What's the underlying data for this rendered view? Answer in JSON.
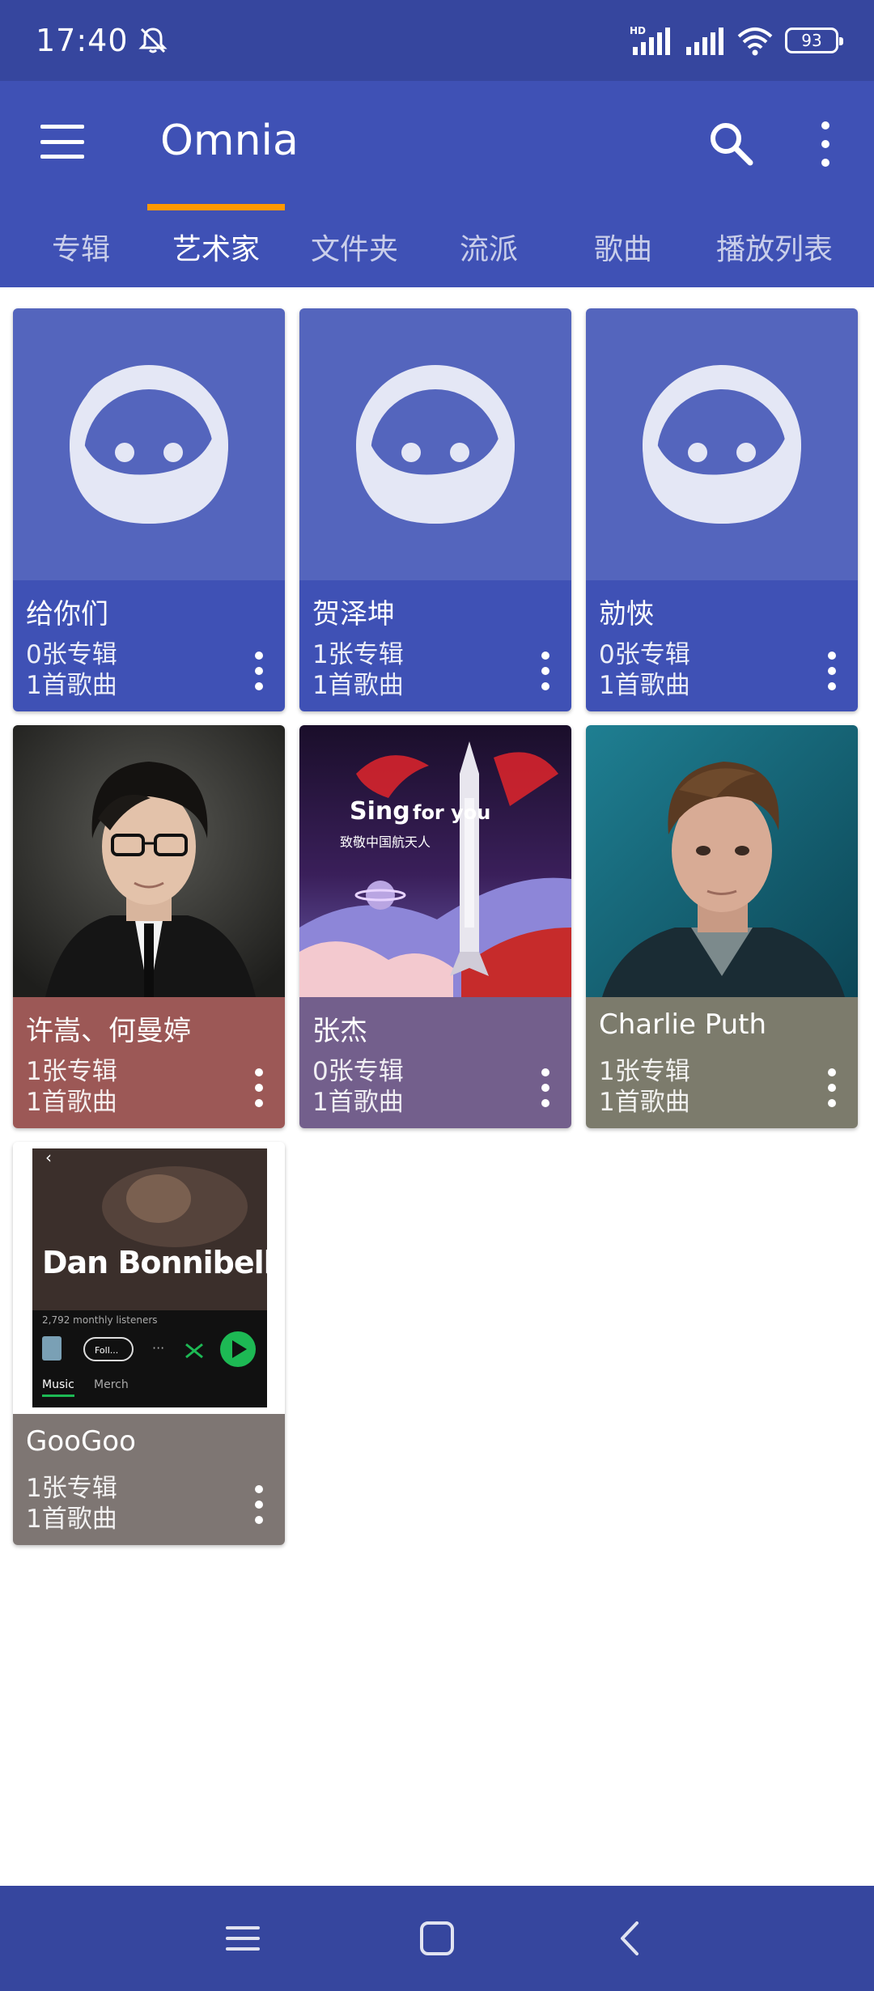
{
  "status": {
    "time": "17:40",
    "battery": "93",
    "icons": [
      "bell-off-icon",
      "hd-signal-icon",
      "signal-icon",
      "wifi-icon",
      "battery-icon"
    ]
  },
  "app_bar": {
    "title": "Omnia",
    "icons": [
      "menu-icon",
      "search-icon",
      "more-vert-icon"
    ]
  },
  "tabs": [
    {
      "label": "专辑"
    },
    {
      "label": "艺术家",
      "active": true
    },
    {
      "label": "文件夹"
    },
    {
      "label": "流派"
    },
    {
      "label": "歌曲"
    },
    {
      "label": "播放列表"
    }
  ],
  "artists": [
    {
      "name": "给你们",
      "albums": "0张专辑",
      "songs": "1首歌曲",
      "color": "#3f51b5",
      "image": "placeholder-face"
    },
    {
      "name": "贺泽坤",
      "albums": "1张专辑",
      "songs": "1首歌曲",
      "color": "#3f51b5",
      "image": "placeholder-face"
    },
    {
      "name": "勍悏",
      "albums": "0张专辑",
      "songs": "1首歌曲",
      "color": "#3f51b5",
      "image": "placeholder-face"
    },
    {
      "name": "许嵩、何曼婷",
      "albums": "1张专辑",
      "songs": "1首歌曲",
      "color": "#9c5856",
      "image": "portrait-photo"
    },
    {
      "name": "张杰",
      "albums": "0张专辑",
      "songs": "1首歌曲",
      "color": "#735f8c",
      "image": "rocket-poster"
    },
    {
      "name": "Charlie Puth",
      "albums": "1张专辑",
      "songs": "1首歌曲",
      "color": "#7c7b6c",
      "image": "portrait-photo"
    },
    {
      "name": "GooGoo",
      "albums": "1张专辑",
      "songs": "1首歌曲",
      "color": "#7e7673",
      "image": "spotify-screenshot"
    }
  ],
  "poster": {
    "sing_text": "Sing",
    "for_you_text": "for you",
    "subtitle": "致敬中国航天人"
  },
  "spotify": {
    "artist": "Dan Bonnibell",
    "listeners": "2,792 monthly listeners",
    "follow": "Foll...",
    "tab_music": "Music",
    "tab_merch": "Merch"
  },
  "nav": {
    "icons": [
      "recents-icon",
      "home-icon",
      "back-icon"
    ]
  }
}
